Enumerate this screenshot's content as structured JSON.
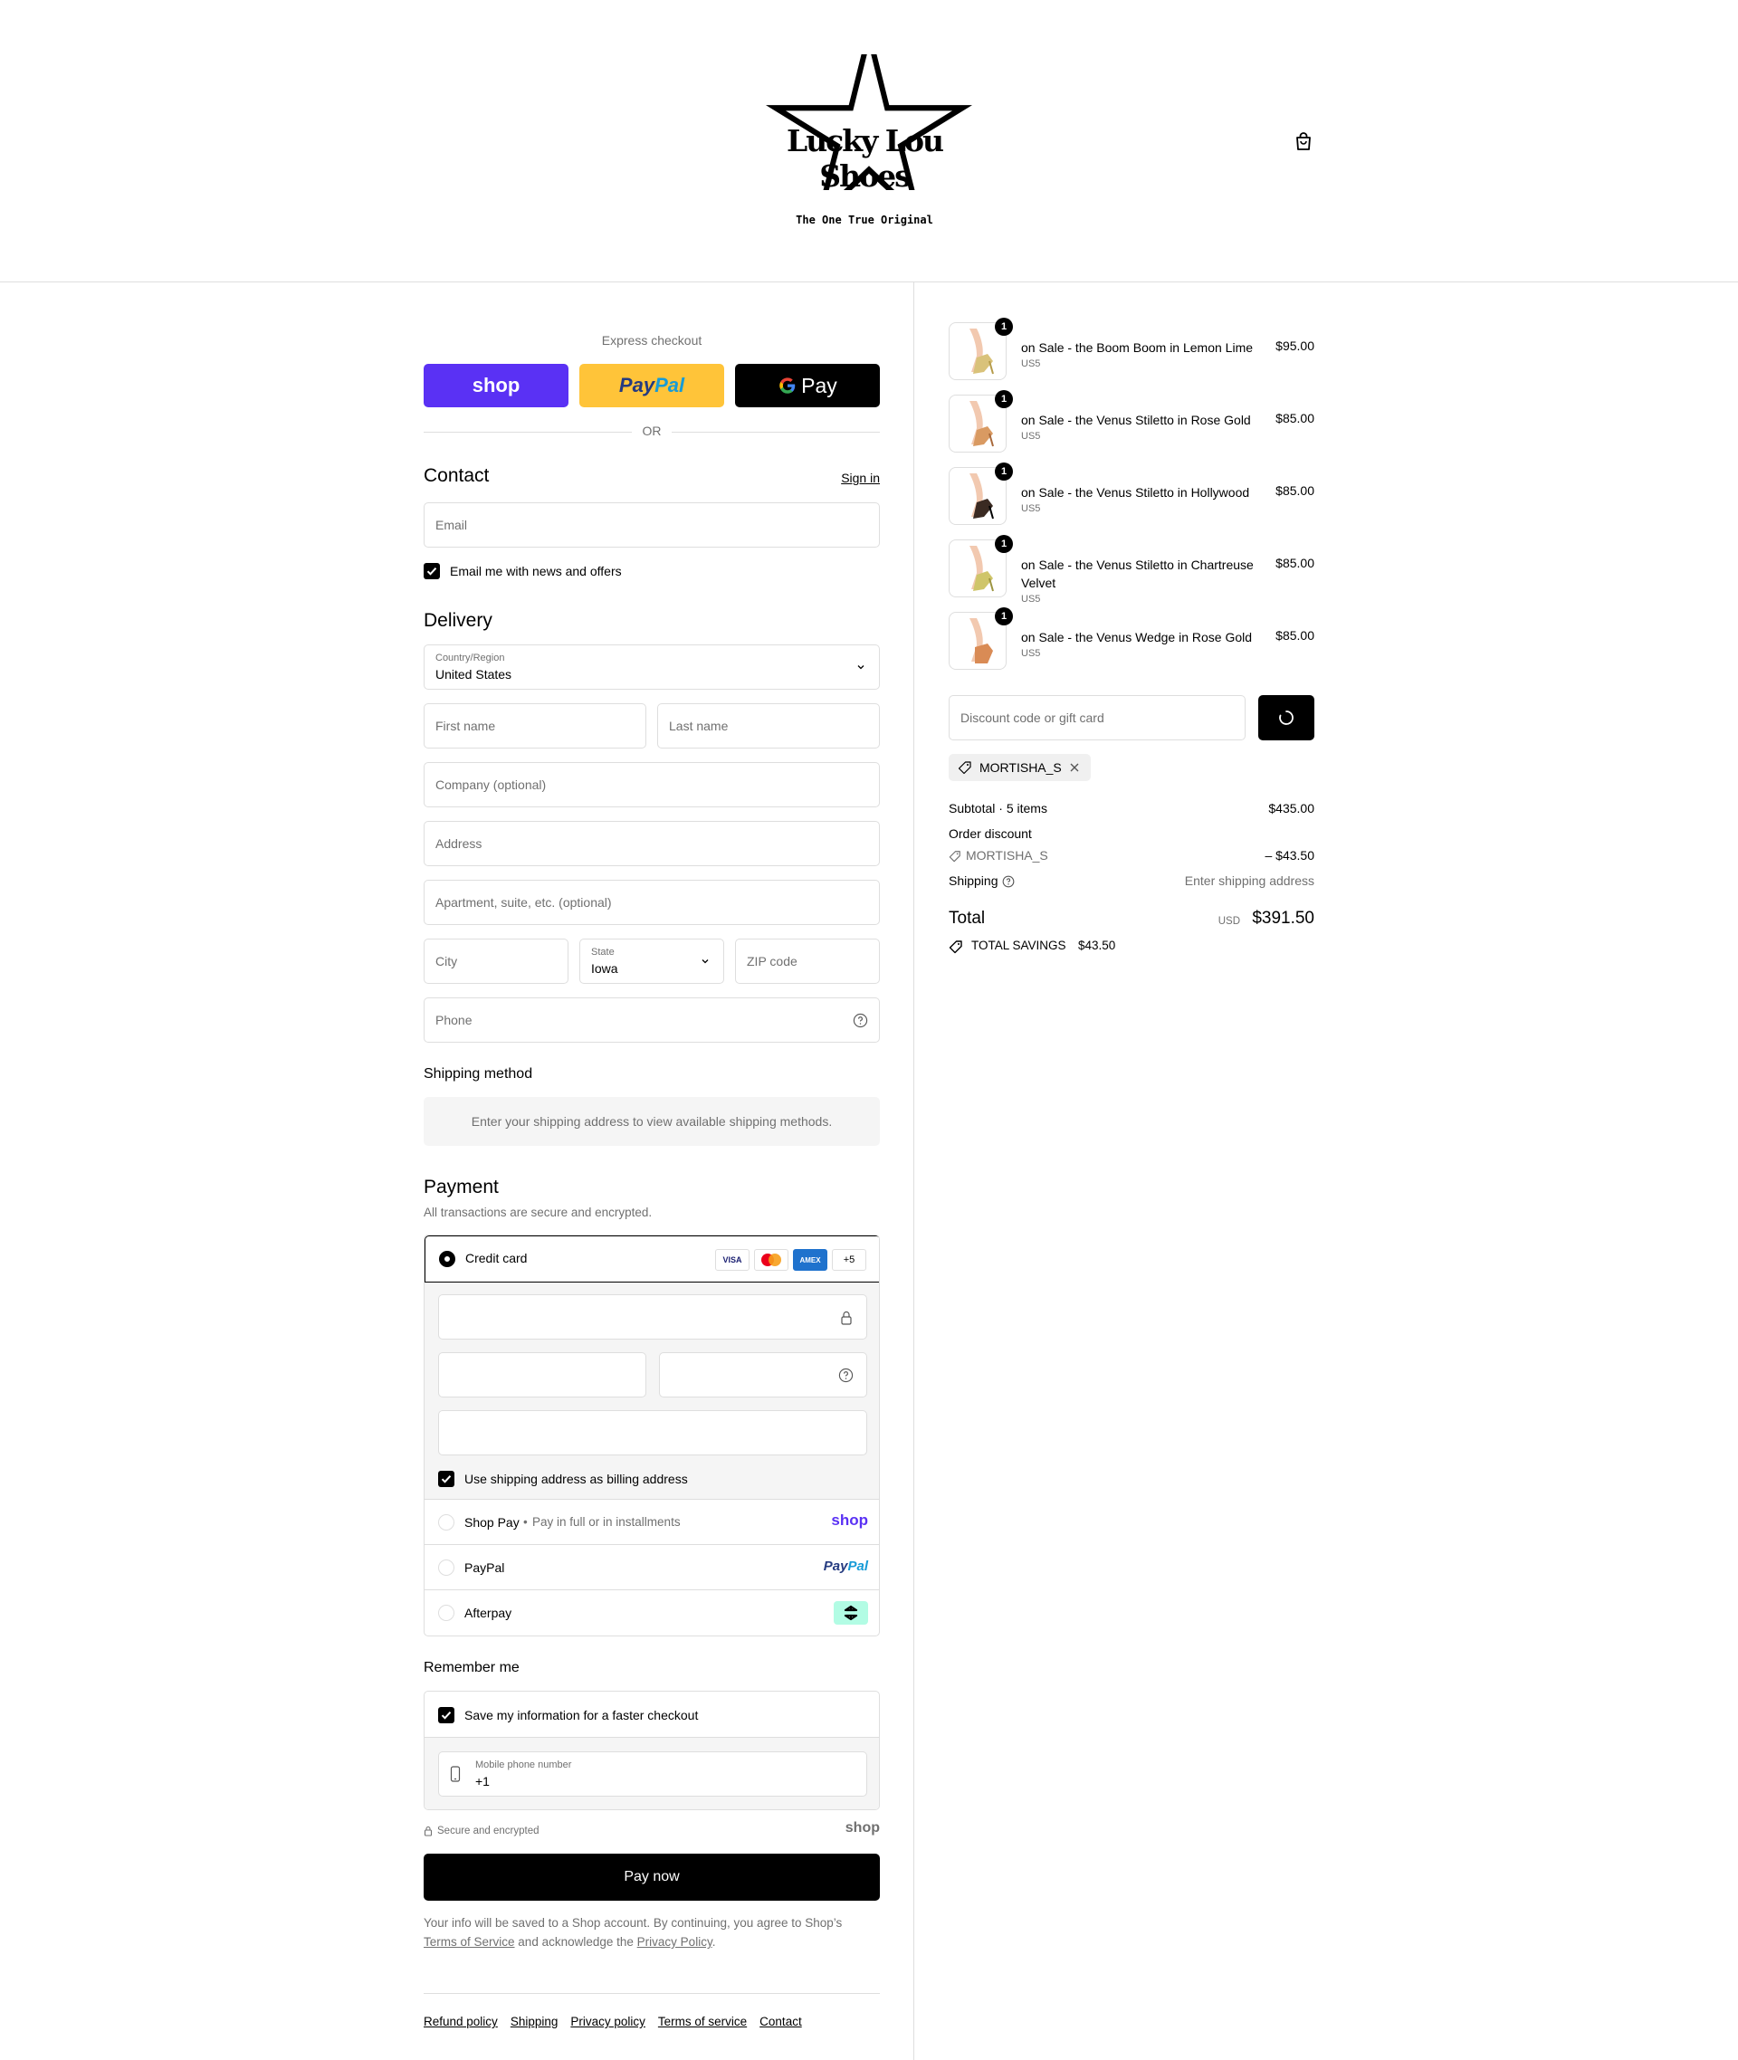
{
  "header": {
    "brand_name": "Lucky Lou Shoes",
    "brand_tagline": "The One True Original"
  },
  "express": {
    "label": "Express checkout",
    "shop_label": "shop",
    "paypal_label_1": "Pay",
    "paypal_label_2": "Pal",
    "gpay_label": "Pay",
    "or_label": "OR"
  },
  "contact": {
    "title": "Contact",
    "sign_in": "Sign in",
    "email_placeholder": "Email",
    "news_label": "Email me with news and offers"
  },
  "delivery": {
    "title": "Delivery",
    "country_label": "Country/Region",
    "country_value": "United States",
    "first_name": "First name",
    "last_name": "Last name",
    "company": "Company (optional)",
    "address": "Address",
    "apartment": "Apartment, suite, etc. (optional)",
    "city": "City",
    "state_label": "State",
    "state_value": "Iowa",
    "zip": "ZIP code",
    "phone": "Phone"
  },
  "shipping_method": {
    "title": "Shipping method",
    "note": "Enter your shipping address to view available shipping methods."
  },
  "payment": {
    "title": "Payment",
    "subtitle": "All transactions are secure and encrypted.",
    "credit_card": "Credit card",
    "card_visa": "VISA",
    "card_amex": "AMEX",
    "more_cards": "+5",
    "billing_same": "Use shipping address as billing address",
    "shop_pay": "Shop Pay",
    "shop_pay_sub": "Pay in full or in installments",
    "shop_logo": "shop",
    "paypal": "PayPal",
    "paypal_logo_1": "Pay",
    "paypal_logo_2": "Pal",
    "afterpay": "Afterpay"
  },
  "remember": {
    "title": "Remember me",
    "save_label": "Save my information for a faster checkout",
    "mobile_label": "Mobile phone number",
    "mobile_value": "+1",
    "secure_label": "Secure and encrypted",
    "shop_logo": "shop"
  },
  "pay_now": "Pay now",
  "legal": {
    "text_1": "Your info will be saved to a Shop account. By continuing, you agree to Shop’s",
    "terms": "Terms of Service",
    "text_2": "and acknowledge the",
    "privacy": "Privacy Policy",
    "text_3": "."
  },
  "footer": {
    "links": [
      "Refund policy",
      "Shipping",
      "Privacy policy",
      "Terms of service",
      "Contact"
    ]
  },
  "cart": {
    "items": [
      {
        "name": "on Sale - the Boom Boom in Lemon Lime",
        "size": "US5",
        "price": "$95.00",
        "qty": "1",
        "color": "#d9c27a"
      },
      {
        "name": "on Sale - the Venus Stiletto in Rose Gold",
        "size": "US5",
        "price": "$85.00",
        "qty": "1",
        "color": "#d99a62"
      },
      {
        "name": "on Sale - the Venus Stiletto in Hollywood",
        "size": "US5",
        "price": "$85.00",
        "qty": "1",
        "color": "#3a2a22"
      },
      {
        "name": "on Sale - the Venus Stiletto in Chartreuse Velvet",
        "size": "US5",
        "price": "$85.00",
        "qty": "1",
        "color": "#cfc56a"
      },
      {
        "name": "on Sale - the Venus Wedge in Rose Gold",
        "size": "US5",
        "price": "$85.00",
        "qty": "1",
        "color": "#d98b55"
      }
    ],
    "discount_placeholder": "Discount code or gift card",
    "applied_code": "MORTISHA_S",
    "subtotal_label": "Subtotal · 5 items",
    "subtotal_value": "$435.00",
    "order_discount_label": "Order discount",
    "discount_code": "MORTISHA_S",
    "discount_value": "– $43.50",
    "shipping_label": "Shipping",
    "shipping_value": "Enter shipping address",
    "total_label": "Total",
    "total_currency": "USD",
    "total_value": "$391.50",
    "savings_label": "TOTAL SAVINGS",
    "savings_value": "$43.50"
  },
  "colors": {
    "shop_purple": "#5a31f4",
    "paypal_yellow": "#ffc439",
    "afterpay_mint": "#b2fce4",
    "border": "#dedede",
    "muted": "#707070"
  }
}
